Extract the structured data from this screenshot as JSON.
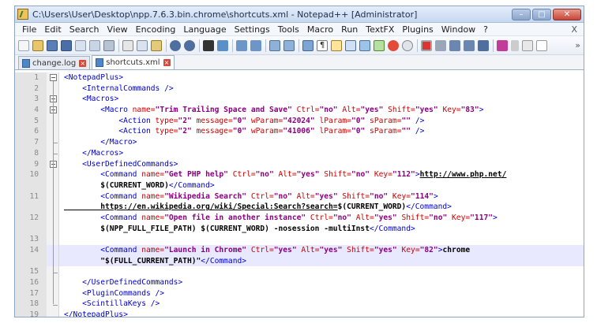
{
  "window": {
    "title": "C:\\Users\\User\\Desktop\\npp.7.6.3.bin.chrome\\shortcuts.xml - Notepad++ [Administrator]"
  },
  "menu": [
    "File",
    "Edit",
    "Search",
    "View",
    "Encoding",
    "Language",
    "Settings",
    "Tools",
    "Macro",
    "Run",
    "TextFX",
    "Plugins",
    "Window",
    "?"
  ],
  "menu_close": "X",
  "toolbar_more": "»",
  "tabs": [
    {
      "label": "change.log",
      "active": false
    },
    {
      "label": "shortcuts.xml",
      "active": true
    }
  ],
  "tab_close_glyph": "×",
  "editor": {
    "highlighted_line": 14,
    "lines": [
      {
        "n": "1",
        "segs": [
          [
            "tag",
            "<NotepadPlus>"
          ]
        ]
      },
      {
        "n": "2",
        "segs": [
          [
            "txt",
            "    "
          ],
          [
            "tag",
            "<InternalCommands />"
          ]
        ]
      },
      {
        "n": "3",
        "segs": [
          [
            "txt",
            "    "
          ],
          [
            "tag",
            "<Macros>"
          ]
        ]
      },
      {
        "n": "4",
        "segs": [
          [
            "txt",
            "        "
          ],
          [
            "tag",
            "<Macro "
          ],
          [
            "attr",
            "name="
          ],
          [
            "val",
            "\"Trim Trailing Space and Save\""
          ],
          [
            "attr",
            " Ctrl="
          ],
          [
            "val",
            "\"no\""
          ],
          [
            "attr",
            " Alt="
          ],
          [
            "val",
            "\"yes\""
          ],
          [
            "attr",
            " Shift="
          ],
          [
            "val",
            "\"yes\""
          ],
          [
            "attr",
            " Key="
          ],
          [
            "val",
            "\"83\""
          ],
          [
            "tag",
            ">"
          ]
        ]
      },
      {
        "n": "5",
        "segs": [
          [
            "txt",
            "            "
          ],
          [
            "tag",
            "<Action "
          ],
          [
            "attr",
            "type="
          ],
          [
            "val",
            "\"2\""
          ],
          [
            "attr",
            " message="
          ],
          [
            "val",
            "\"0\""
          ],
          [
            "attr",
            " wParam="
          ],
          [
            "val",
            "\"42024\""
          ],
          [
            "attr",
            " lParam="
          ],
          [
            "val",
            "\"0\""
          ],
          [
            "attr",
            " sParam="
          ],
          [
            "val",
            "\"\""
          ],
          [
            "tag",
            " />"
          ]
        ]
      },
      {
        "n": "6",
        "segs": [
          [
            "txt",
            "            "
          ],
          [
            "tag",
            "<Action "
          ],
          [
            "attr",
            "type="
          ],
          [
            "val",
            "\"2\""
          ],
          [
            "attr",
            " message="
          ],
          [
            "val",
            "\"0\""
          ],
          [
            "attr",
            " wParam="
          ],
          [
            "val",
            "\"41006\""
          ],
          [
            "attr",
            " lParam="
          ],
          [
            "val",
            "\"0\""
          ],
          [
            "attr",
            " sParam="
          ],
          [
            "val",
            "\"\""
          ],
          [
            "tag",
            " />"
          ]
        ]
      },
      {
        "n": "7",
        "segs": [
          [
            "txt",
            "        "
          ],
          [
            "tag",
            "</Macro>"
          ]
        ]
      },
      {
        "n": "8",
        "segs": [
          [
            "txt",
            "    "
          ],
          [
            "tag",
            "</Macros>"
          ]
        ]
      },
      {
        "n": "9",
        "segs": [
          [
            "txt",
            "    "
          ],
          [
            "tag",
            "<UserDefinedCommands>"
          ]
        ]
      },
      {
        "n": "10",
        "segs": [
          [
            "txt",
            "        "
          ],
          [
            "tag",
            "<Command "
          ],
          [
            "attr",
            "name="
          ],
          [
            "val",
            "\"Get PHP help\""
          ],
          [
            "attr",
            " Ctrl="
          ],
          [
            "val",
            "\"no\""
          ],
          [
            "attr",
            " Alt="
          ],
          [
            "val",
            "\"yes\""
          ],
          [
            "attr",
            " Shift="
          ],
          [
            "val",
            "\"no\""
          ],
          [
            "attr",
            " Key="
          ],
          [
            "val",
            "\"112\""
          ],
          [
            "tag",
            ">"
          ],
          [
            "url",
            "http://www.php.net/"
          ]
        ]
      },
      {
        "n": "",
        "segs": [
          [
            "txt",
            "        $(CURRENT_WORD)"
          ],
          [
            "tag",
            "</Command>"
          ]
        ]
      },
      {
        "n": "11",
        "segs": [
          [
            "txt",
            "        "
          ],
          [
            "tag",
            "<Command "
          ],
          [
            "attr",
            "name="
          ],
          [
            "val",
            "\"Wikipedia Search\""
          ],
          [
            "attr",
            " Ctrl="
          ],
          [
            "val",
            "\"no\""
          ],
          [
            "attr",
            " Alt="
          ],
          [
            "val",
            "\"yes\""
          ],
          [
            "attr",
            " Shift="
          ],
          [
            "val",
            "\"no\""
          ],
          [
            "attr",
            " Key="
          ],
          [
            "val",
            "\"114\""
          ],
          [
            "tag",
            ">"
          ]
        ]
      },
      {
        "n": "",
        "segs": [
          [
            "url",
            "        https://en.wikipedia.org/wiki/Special:Search?search="
          ],
          [
            "txt",
            "$(CURRENT_WORD)"
          ],
          [
            "tag",
            "</Command>"
          ]
        ]
      },
      {
        "n": "12",
        "segs": [
          [
            "txt",
            "        "
          ],
          [
            "tag",
            "<Command "
          ],
          [
            "attr",
            "name="
          ],
          [
            "val",
            "\"Open file in another instance\""
          ],
          [
            "attr",
            " Ctrl="
          ],
          [
            "val",
            "\"no\""
          ],
          [
            "attr",
            " Alt="
          ],
          [
            "val",
            "\"yes\""
          ],
          [
            "attr",
            " Shift="
          ],
          [
            "val",
            "\"no\""
          ],
          [
            "attr",
            " Key="
          ],
          [
            "val",
            "\"117\""
          ],
          [
            "tag",
            ">"
          ]
        ]
      },
      {
        "n": "",
        "segs": [
          [
            "txt",
            "        $(NPP_FULL_FILE_PATH) $(CURRENT_WORD) -nosession -multiInst"
          ],
          [
            "tag",
            "</Command>"
          ]
        ]
      },
      {
        "n": "13",
        "segs": [
          [
            "txt",
            ""
          ]
        ]
      },
      {
        "n": "14",
        "segs": [
          [
            "txt",
            "        "
          ],
          [
            "tag",
            "<Command "
          ],
          [
            "attr",
            "name="
          ],
          [
            "val",
            "\"Launch in Chrome\""
          ],
          [
            "attr",
            " Ctrl="
          ],
          [
            "val",
            "\"yes\""
          ],
          [
            "attr",
            " Alt="
          ],
          [
            "val",
            "\"yes\""
          ],
          [
            "attr",
            " Shift="
          ],
          [
            "val",
            "\"yes\""
          ],
          [
            "attr",
            " Key="
          ],
          [
            "val",
            "\"82\""
          ],
          [
            "tag",
            ">"
          ],
          [
            "txt",
            "chrome"
          ]
        ]
      },
      {
        "n": "",
        "segs": [
          [
            "txt",
            "        \"$(FULL_CURRENT_PATH)\""
          ],
          [
            "tag",
            "</Command>"
          ]
        ]
      },
      {
        "n": "15",
        "segs": [
          [
            "txt",
            ""
          ]
        ]
      },
      {
        "n": "16",
        "segs": [
          [
            "txt",
            "    "
          ],
          [
            "tag",
            "</UserDefinedCommands>"
          ]
        ]
      },
      {
        "n": "17",
        "segs": [
          [
            "txt",
            "    "
          ],
          [
            "tag",
            "<PluginCommands />"
          ]
        ]
      },
      {
        "n": "18",
        "segs": [
          [
            "txt",
            "    "
          ],
          [
            "tag",
            "<ScintillaKeys />"
          ]
        ]
      },
      {
        "n": "19",
        "segs": [
          [
            "tag",
            "</NotepadPlus>"
          ]
        ]
      }
    ]
  },
  "colors": {
    "tag": "#0000cc",
    "attribute": "#cc0000",
    "value": "#8b0080",
    "highlight": "#e8e8ff"
  }
}
